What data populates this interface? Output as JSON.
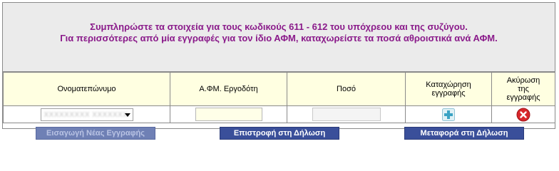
{
  "header": {
    "line1": "Συμπληρώστε τα στοιχεία για τους κωδικούς 611 - 612 του υπόχρεου και της συζύγου.",
    "line2": "Για περισσότερες από μία εγγραφές για τον ίδιο ΑΦΜ, καταχωρείστε τα ποσά αθροιστικά ανά ΑΦΜ."
  },
  "colors": {
    "header_text": "#8a1a8a",
    "header_bg": "#ebebeb",
    "column_header_bg": "#ffffe1",
    "button_bg": "#3a4f9a"
  },
  "table": {
    "columns": [
      "Ονοματεπώνυμο",
      "Α.ΦΜ. Εργοδότη",
      "Ποσό",
      "Καταχώρηση εγγραφής",
      "Ακύρωση της εγγραφής"
    ],
    "row": {
      "name_select_value": "ΧΧΧΧΧΧΧΧΧ ΧΧΧΧΧΧΧ",
      "afm_value": "",
      "amount_value": "",
      "add_icon": "plus-icon",
      "delete_icon": "cancel-icon"
    }
  },
  "buttons": {
    "new_entry": "Εισαγωγή Νέας Εγγραφής",
    "return": "Επιστροφή στη Δήλωση",
    "transfer": "Μεταφορά στη Δήλωση"
  }
}
